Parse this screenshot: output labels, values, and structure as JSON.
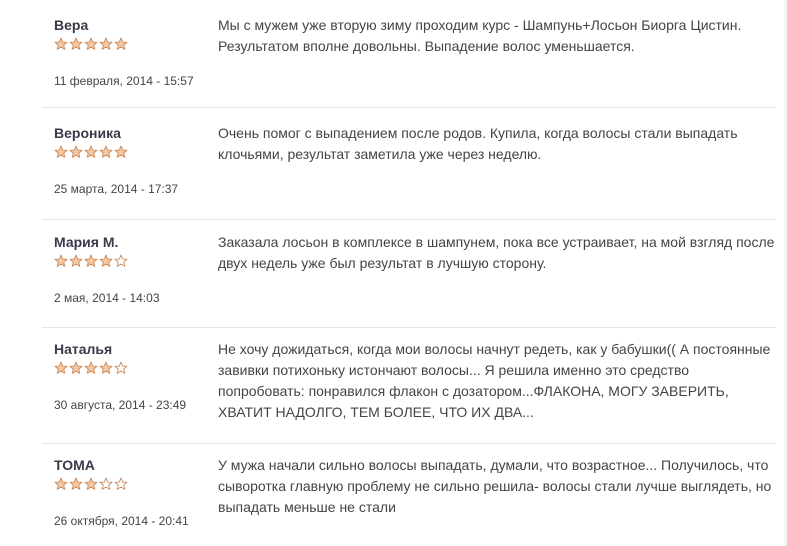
{
  "colors": {
    "star_fill": "#f5c9a6",
    "star_stroke": "#c98a5c",
    "divider": "#e6e6e6"
  },
  "reviews": [
    {
      "author": "Вера",
      "rating": 5,
      "date": "11 февраля, 2014 - 15:57",
      "text": "Мы с мужем уже вторую зиму проходим курс - Шампунь+Лосьон Биорга Цистин. Результатом вполне довольны. Выпадение волос уменьшается."
    },
    {
      "author": "Вероника",
      "rating": 5,
      "date": "25 марта, 2014 - 17:37",
      "text": "Очень помог с выпадением после родов. Купила, когда волосы стали выпадать клочьями, результат заметила уже через неделю."
    },
    {
      "author": "Мария М.",
      "rating": 4,
      "date": "2 мая, 2014 - 14:03",
      "text": "Заказала лосьон в комплексе в шампунем, пока все устраивает, на мой взгляд после двух недель уже был результат в лучшую сторону."
    },
    {
      "author": "Наталья",
      "rating": 4,
      "date": "30 августа, 2014 - 23:49",
      "text": "Не хочу дожидаться, когда мои волосы начнут редеть, как у бабушки(( А постоянные завивки потихоньку истончают волосы... Я решила именно это средство попробовать: понравился флакон с дозатором...ФЛАКОНА, МОГУ ЗАВЕРИТЬ, ХВАТИТ НАДОЛГО, ТЕМ БОЛЕЕ, ЧТО ИХ ДВА..."
    },
    {
      "author": "ТОМА",
      "rating": 3,
      "date": "26 октября, 2014 - 20:41",
      "text": "У мужа начали сильно волосы выпадать, думали, что возрастное... Получилось, что сыворотка главную проблему не сильно решила- волосы стали лучше выглядеть, но выпадать меньше не стали"
    }
  ]
}
